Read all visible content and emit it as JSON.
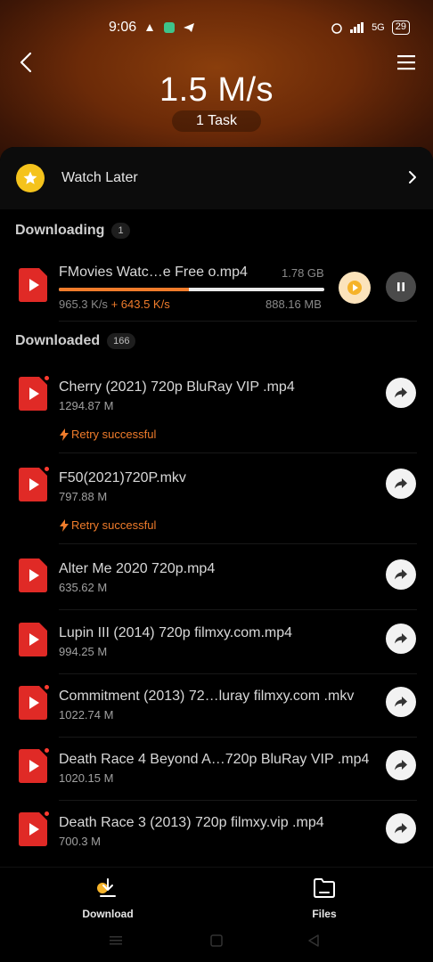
{
  "status_bar": {
    "time": "9:06",
    "signal_text": "5G",
    "battery": "29"
  },
  "header": {
    "speed": "1.5 M/s",
    "tasks": "1 Task"
  },
  "watch_later": {
    "label": "Watch Later"
  },
  "downloading": {
    "title": "Downloading",
    "count": "1",
    "item": {
      "name": "FMovies Watc…e Free o.mp4",
      "total_size": "1.78 GB",
      "speed": "965.3 K/s",
      "boost": "+ 643.5 K/s",
      "downloaded": "888.16 MB",
      "progress": 0.49
    }
  },
  "downloaded": {
    "title": "Downloaded",
    "count": "166",
    "retry_label": "Retry successful",
    "items": [
      {
        "name": "Cherry (2021)  720p  BluRay  VIP .mp4",
        "size": "1294.87 M",
        "retry": true,
        "dot": true
      },
      {
        "name": "F50(2021)720P.mkv",
        "size": "797.88 M",
        "retry": true,
        "dot": true
      },
      {
        "name": "Alter Me 2020 720p.mp4",
        "size": "635.62 M",
        "retry": false,
        "dot": false
      },
      {
        "name": "Lupin III (2014)  720p  filmxy.com.mp4",
        "size": "994.25 M",
        "retry": false,
        "dot": false
      },
      {
        "name": "Commitment (2013)  72…luray  filmxy.com .mkv",
        "size": "1022.74 M",
        "retry": false,
        "dot": true
      },
      {
        "name": "Death Race 4 Beyond A…720p  BluRay  VIP .mp4",
        "size": "1020.15 M",
        "retry": false,
        "dot": true
      },
      {
        "name": "Death Race 3 (2013)  720p   filmxy.vip .mp4",
        "size": "700.3 M",
        "retry": false,
        "dot": true
      }
    ]
  },
  "bottom_tabs": {
    "download": "Download",
    "files": "Files"
  },
  "colors": {
    "accent": "#f07c2b",
    "file_icon": "#e02a26",
    "star": "#f5c31c"
  },
  "icons": [
    "back-icon",
    "menu-icon",
    "star-icon",
    "chevron-right-icon",
    "file-video-icon",
    "play-icon",
    "pause-icon",
    "share-icon",
    "lightning-icon",
    "download-icon",
    "folder-icon"
  ]
}
